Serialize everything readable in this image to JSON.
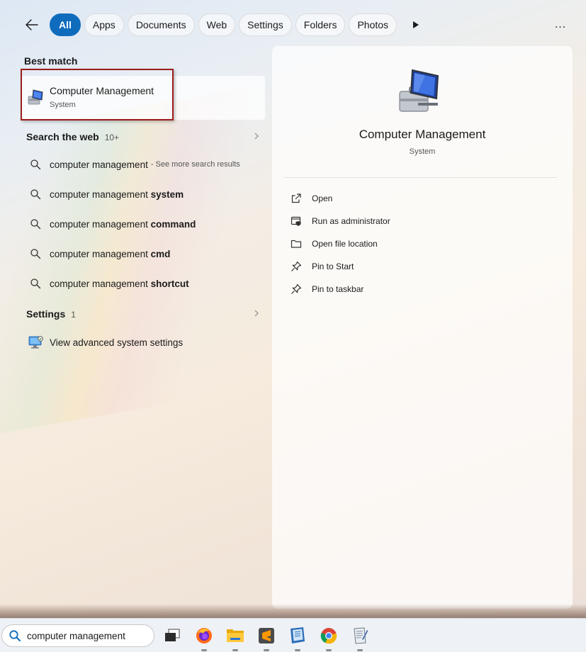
{
  "filters": {
    "back_label": "Back",
    "chips": [
      "All",
      "Apps",
      "Documents",
      "Web",
      "Settings",
      "Folders",
      "Photos"
    ],
    "active": "All",
    "more_label": "..."
  },
  "best_match": {
    "section": "Best match",
    "name": "Computer Management",
    "subtitle": "System"
  },
  "web": {
    "section": "Search the web",
    "count": "10+",
    "results": [
      {
        "plain": "computer management",
        "bold": "",
        "note": "- See more search results"
      },
      {
        "plain": "computer management ",
        "bold": "system",
        "note": ""
      },
      {
        "plain": "computer management ",
        "bold": "command",
        "note": ""
      },
      {
        "plain": "computer management ",
        "bold": "cmd",
        "note": ""
      },
      {
        "plain": "computer management ",
        "bold": "shortcut",
        "note": ""
      }
    ]
  },
  "settings": {
    "section": "Settings",
    "count": "1",
    "item": "View advanced system settings"
  },
  "preview": {
    "title": "Computer Management",
    "subtitle": "System",
    "actions": [
      "Open",
      "Run as administrator",
      "Open file location",
      "Pin to Start",
      "Pin to taskbar"
    ]
  },
  "taskbar": {
    "search_value": "computer management",
    "apps": [
      "task-view",
      "firefox",
      "file-explorer",
      "sublime-text",
      "notebook-app",
      "chrome",
      "notepad-app"
    ]
  },
  "colors": {
    "accent": "#0f6cbd",
    "highlight_outline": "#9b1c1c"
  }
}
